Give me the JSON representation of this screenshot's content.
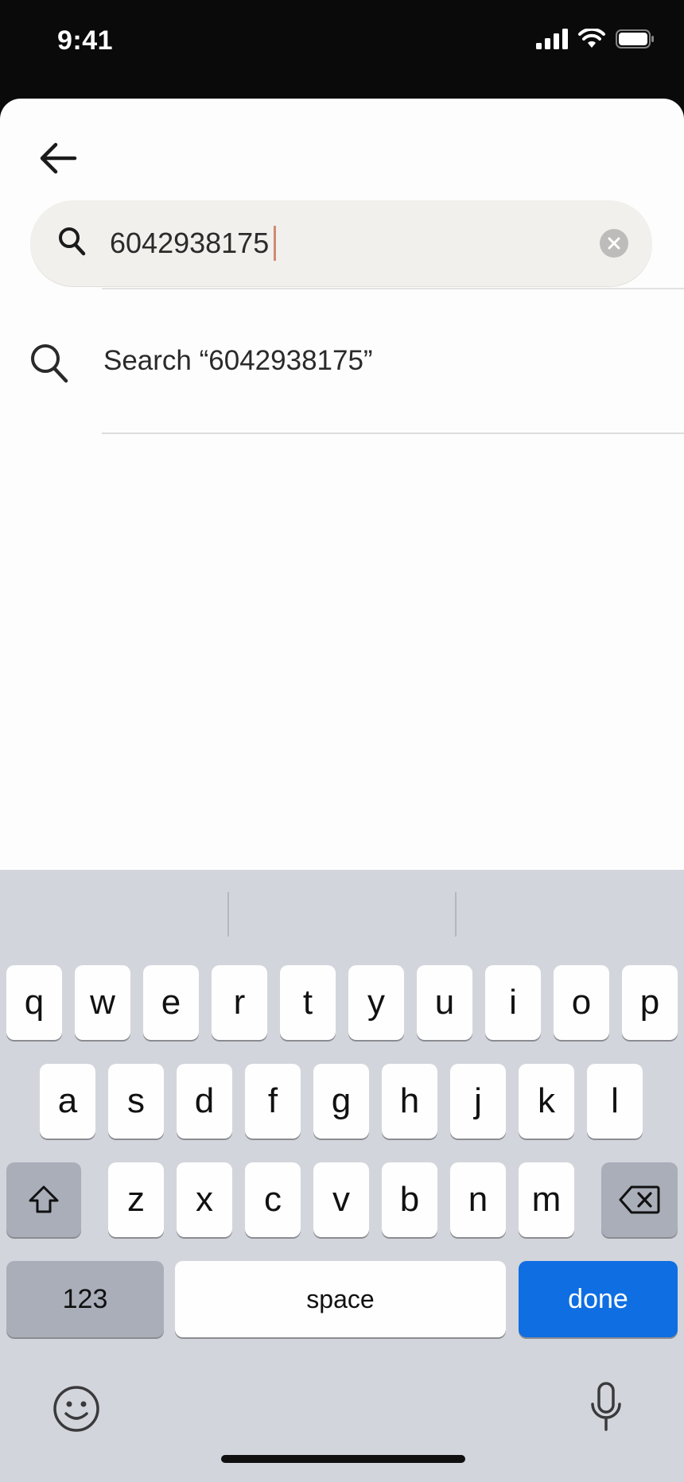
{
  "status_bar": {
    "time": "9:41"
  },
  "search": {
    "query": "6042938175"
  },
  "suggestion": {
    "label": "Search “6042938175”"
  },
  "keyboard": {
    "row1": [
      "q",
      "w",
      "e",
      "r",
      "t",
      "y",
      "u",
      "i",
      "o",
      "p"
    ],
    "row2": [
      "a",
      "s",
      "d",
      "f",
      "g",
      "h",
      "j",
      "k",
      "l"
    ],
    "row3": [
      "z",
      "x",
      "c",
      "v",
      "b",
      "n",
      "m"
    ],
    "numbers_label": "123",
    "space_label": "space",
    "done_label": "done"
  },
  "icons": {
    "back": "arrow-left-icon",
    "search": "search-icon",
    "clear": "clear-icon",
    "shift": "shift-icon",
    "delete": "backspace-icon",
    "emoji": "emoji-icon",
    "mic": "microphone-icon"
  },
  "colors": {
    "accent": "#0f6ee2",
    "caret": "#d08a72"
  }
}
